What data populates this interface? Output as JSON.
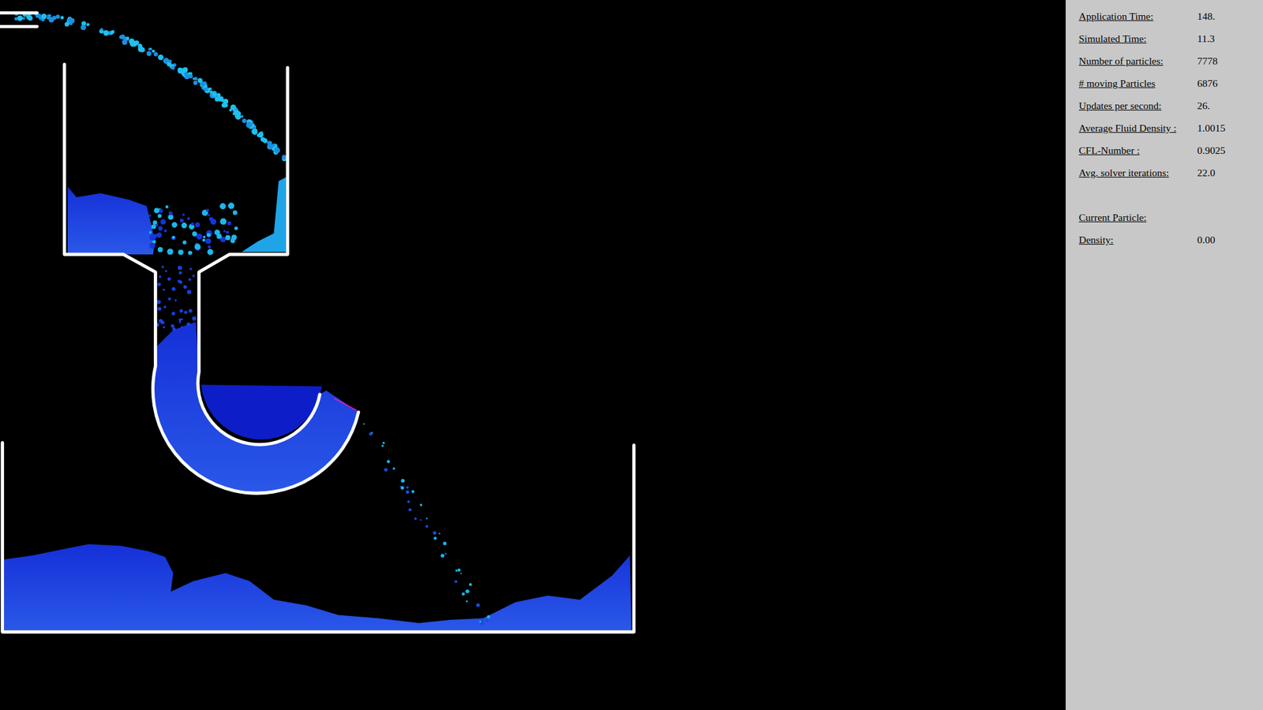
{
  "stats": [
    {
      "label": "Application Time:",
      "value": "148."
    },
    {
      "label": "Simulated Time:",
      "value": "11.3"
    },
    {
      "label": "Number of particles:",
      "value": "7778"
    },
    {
      "label": "# moving Particles",
      "value": "6876"
    },
    {
      "label": "Updates per second:",
      "value": "26."
    },
    {
      "label": "Average Fluid Density :",
      "value": "1.0015"
    },
    {
      "label": "CFL-Number :",
      "value": "0.9025"
    },
    {
      "label": "Avg. solver iterations:",
      "value": "22.0"
    }
  ],
  "particle": [
    {
      "label": "Current Particle:"
    },
    {
      "label": "Density:",
      "value": "0.00"
    }
  ]
}
